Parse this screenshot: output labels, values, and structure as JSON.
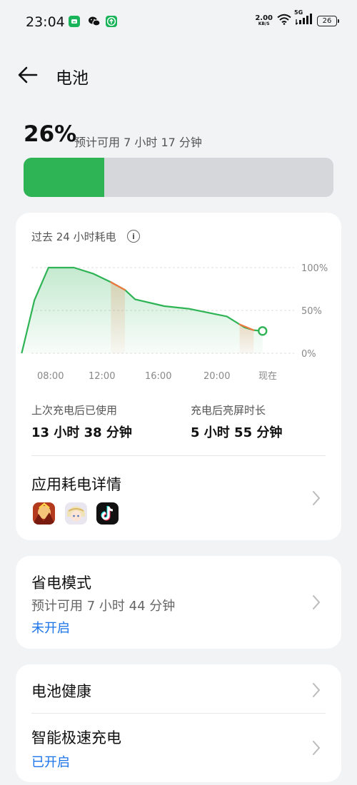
{
  "status_bar": {
    "time": "23:04",
    "net_speed_value": "2.00",
    "net_speed_unit": "KB/S",
    "network_type": "5G",
    "battery_level": "26",
    "app_icons": [
      "chat-bubble-icon",
      "wechat-icon",
      "upload-icon"
    ]
  },
  "header": {
    "title": "电池",
    "back_icon": "arrow-left-icon"
  },
  "battery": {
    "percent": "26%",
    "estimate": "预计可用 7 小时 17 分钟",
    "level_fraction": 0.26,
    "fill_color": "#2eb355"
  },
  "usage_card": {
    "title": "过去 24 小时耗电",
    "info_icon": "info-icon",
    "stats": [
      {
        "label": "上次充电后已使用",
        "value": "13 小时 38 分钟"
      },
      {
        "label": "充电后亮屏时长",
        "value": "5 小时 55 分钟"
      }
    ],
    "details_title": "应用耗电详情",
    "details_apps": [
      "honor-of-kings-app-icon",
      "genshin-impact-app-icon",
      "tiktok-app-icon"
    ]
  },
  "chart_data": {
    "type": "area",
    "x_tick_labels": [
      "08:00",
      "12:00",
      "16:00",
      "20:00",
      "现在"
    ],
    "y_tick_labels": [
      "100%",
      "50%",
      "0%"
    ],
    "ylim": [
      0,
      100
    ],
    "grid": true,
    "line_color": "#2eb355",
    "discharge_highlight_color": "#f0763e",
    "x_hours": [
      6.9,
      7.9,
      9.0,
      11.0,
      12.5,
      13.9,
      15.0,
      15.8,
      18.1,
      20.0,
      23.0,
      24.4,
      25.1,
      25.8
    ],
    "y_percent": [
      0,
      62,
      100,
      100,
      93,
      83,
      74,
      63,
      55,
      52,
      43,
      30,
      27,
      26
    ],
    "highlighted_discharge_ranges": [
      [
        13.9,
        15.0
      ],
      [
        24.0,
        25.1
      ]
    ]
  },
  "power_saver_card": {
    "title": "省电模式",
    "subtitle": "预计可用 7 小时 44 分钟",
    "status": "未开启",
    "status_color": "#1a73e8"
  },
  "health_card": {
    "items": [
      {
        "title": "电池健康"
      },
      {
        "title": "智能极速充电",
        "status": "已开启"
      }
    ],
    "status_color": "#1a73e8"
  },
  "icons": {
    "chevron": "chevron-right-icon"
  }
}
